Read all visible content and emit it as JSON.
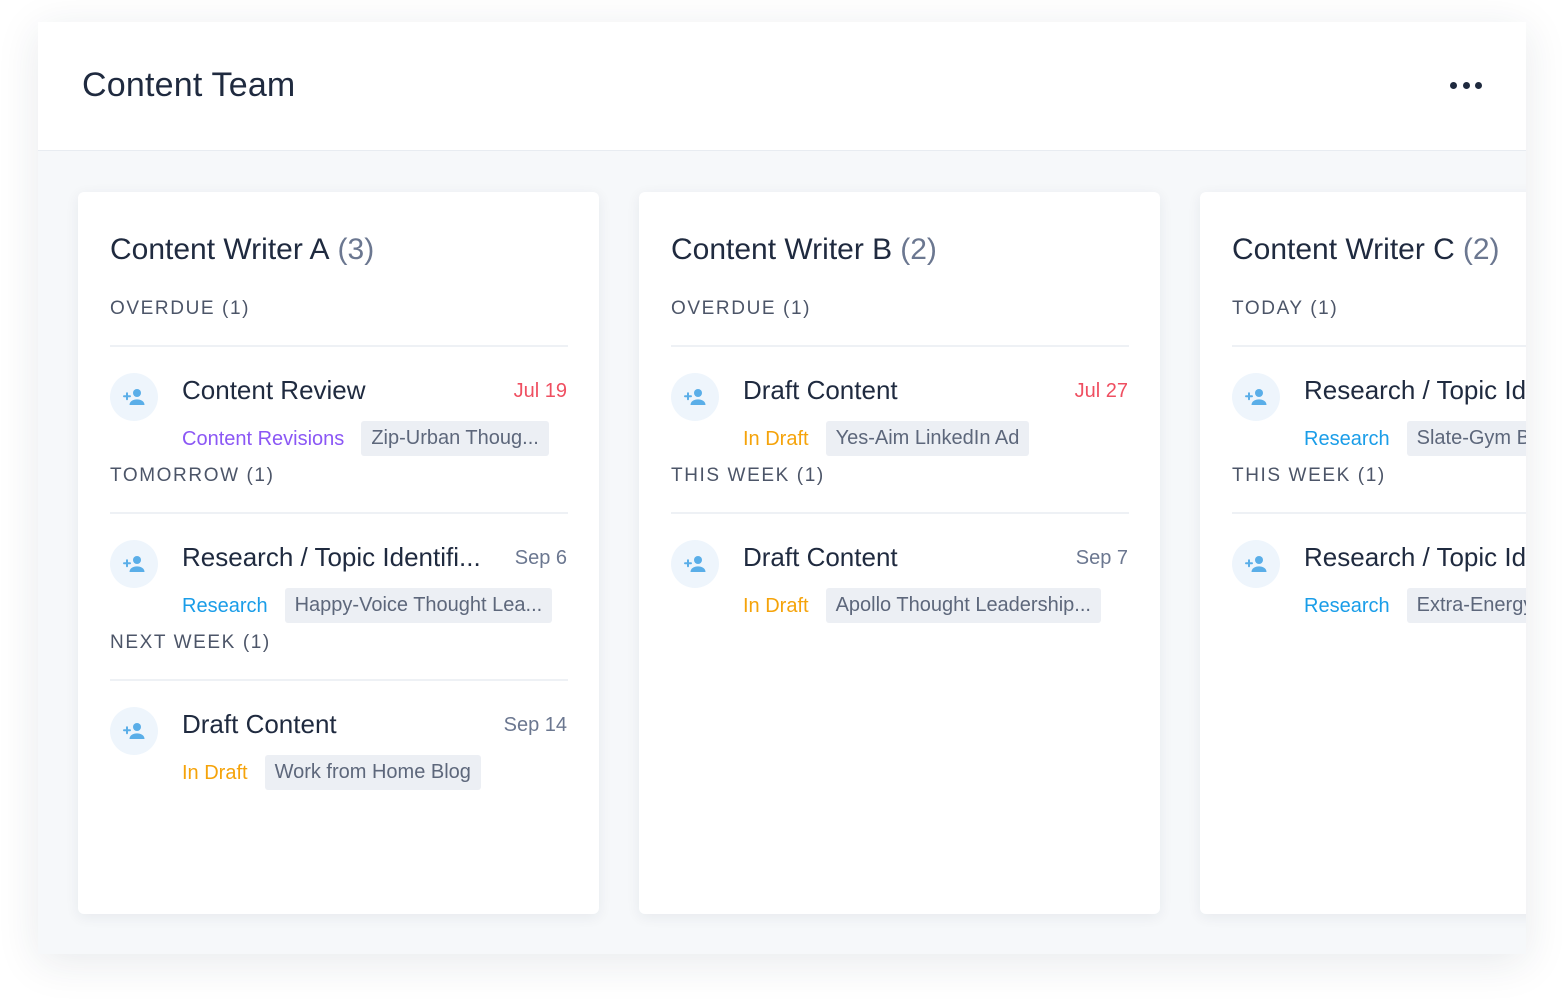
{
  "header": {
    "title": "Content Team",
    "more_icon": "ellipsis-horizontal-icon"
  },
  "colors": {
    "overdue_date": "#ef4f61",
    "status_purple": "#8b57f5",
    "status_blue": "#1a9de8",
    "status_orange": "#f5a30a",
    "avatar_icon": "#5aaee8"
  },
  "columns": [
    {
      "name": "Content Writer A",
      "count": "(3)",
      "groups": [
        {
          "label": "OVERDUE (1)",
          "tasks": [
            {
              "title": "Content Review",
              "date": "Jul 19",
              "overdue": true,
              "status": "Content Revisions",
              "status_color": "purple",
              "project": "Zip-Urban Thoug..."
            }
          ]
        },
        {
          "label": "TOMORROW (1)",
          "tasks": [
            {
              "title": "Research / Topic Identifi...",
              "date": "Sep 6",
              "overdue": false,
              "status": "Research",
              "status_color": "blue",
              "project": "Happy-Voice Thought Lea..."
            }
          ]
        },
        {
          "label": "NEXT WEEK (1)",
          "tasks": [
            {
              "title": "Draft Content",
              "date": "Sep 14",
              "overdue": false,
              "status": "In Draft",
              "status_color": "orange",
              "project": "Work from Home Blog"
            }
          ]
        }
      ]
    },
    {
      "name": "Content Writer B",
      "count": "(2)",
      "groups": [
        {
          "label": "OVERDUE (1)",
          "tasks": [
            {
              "title": "Draft Content",
              "date": "Jul 27",
              "overdue": true,
              "status": "In Draft",
              "status_color": "orange",
              "project": "Yes-Aim LinkedIn Ad"
            }
          ]
        },
        {
          "label": "THIS WEEK (1)",
          "tasks": [
            {
              "title": "Draft Content",
              "date": "Sep 7",
              "overdue": false,
              "status": "In Draft",
              "status_color": "orange",
              "project": "Apollo Thought Leadership..."
            }
          ]
        }
      ]
    },
    {
      "name": "Content Writer C",
      "count": "(2)",
      "groups": [
        {
          "label": "TODAY (1)",
          "tasks": [
            {
              "title": "Research / Topic Identifi...",
              "date": "",
              "overdue": false,
              "status": "Research",
              "status_color": "blue",
              "project": "Slate-Gym Blog"
            }
          ]
        },
        {
          "label": "THIS WEEK (1)",
          "tasks": [
            {
              "title": "Research / Topic Identifi...",
              "date": "",
              "overdue": false,
              "status": "Research",
              "status_color": "blue",
              "project": "Extra-Energy Blog"
            }
          ]
        }
      ]
    }
  ]
}
